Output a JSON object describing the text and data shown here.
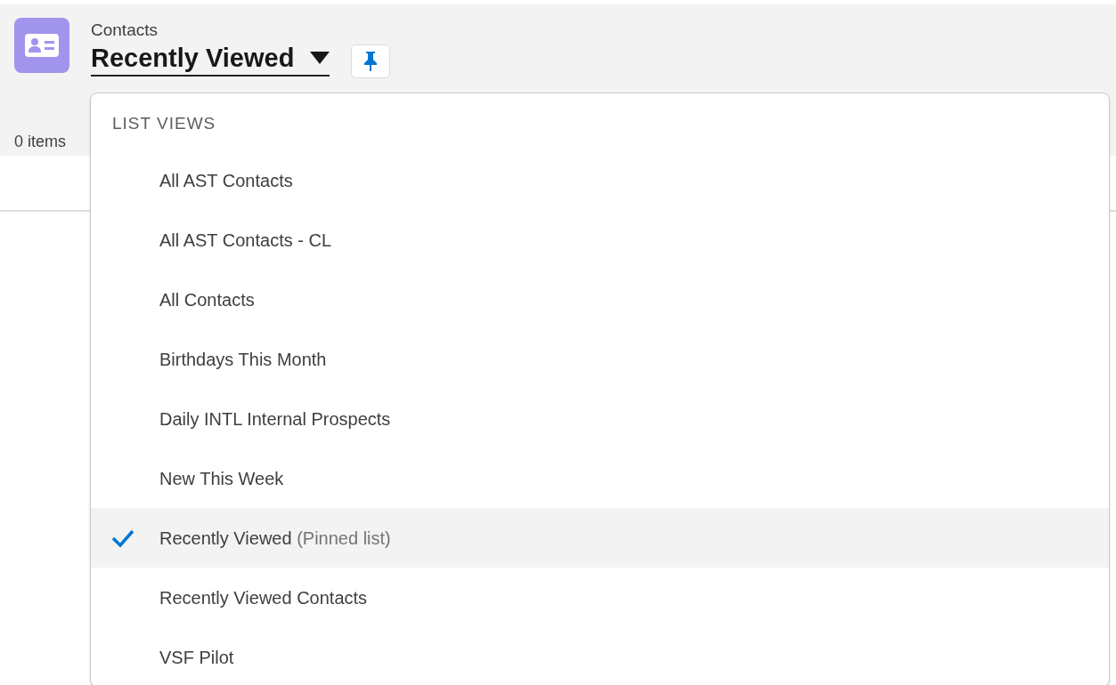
{
  "header": {
    "object_name": "Contacts",
    "list_view": "Recently Viewed",
    "pinned": true
  },
  "item_count": "0 items",
  "dropdown": {
    "heading": "LIST VIEWS",
    "items": [
      {
        "label": "All AST Contacts",
        "selected": false
      },
      {
        "label": "All AST Contacts - CL",
        "selected": false
      },
      {
        "label": "All Contacts",
        "selected": false
      },
      {
        "label": "Birthdays This Month",
        "selected": false
      },
      {
        "label": "Daily INTL Internal Prospects",
        "selected": false
      },
      {
        "label": "New This Week",
        "selected": false
      },
      {
        "label": "Recently Viewed",
        "note": "(Pinned list)",
        "selected": true
      },
      {
        "label": "Recently Viewed Contacts",
        "selected": false
      },
      {
        "label": "VSF Pilot",
        "selected": false
      }
    ]
  }
}
